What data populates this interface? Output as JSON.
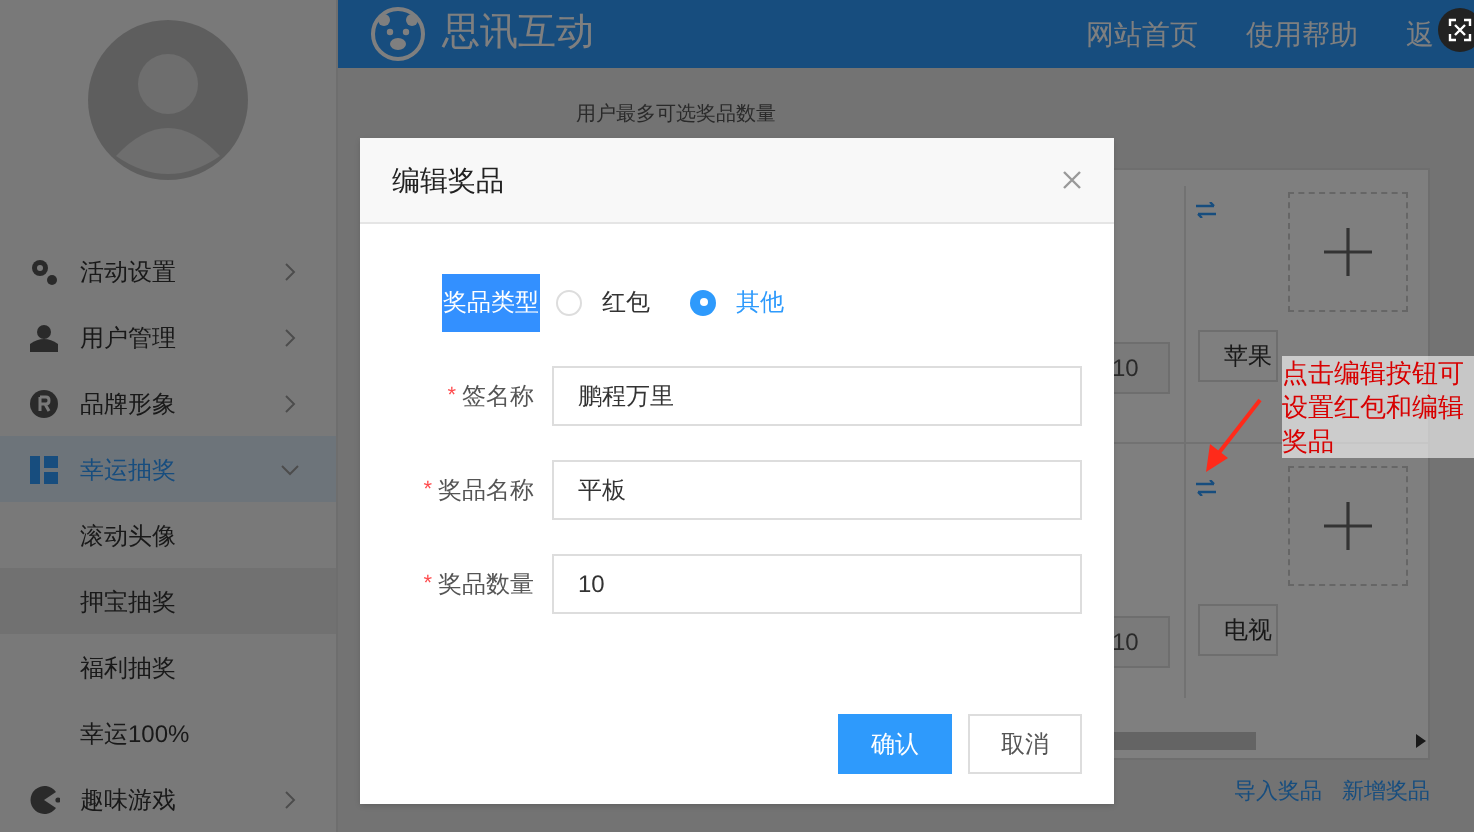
{
  "header": {
    "logo_text": "思讯互动",
    "nav": [
      "网站首页",
      "使用帮助",
      "返"
    ]
  },
  "sidebar": {
    "items": [
      {
        "label": "活动设置",
        "expanded": false,
        "selected": false
      },
      {
        "label": "用户管理",
        "expanded": false,
        "selected": false
      },
      {
        "label": "品牌形象",
        "expanded": false,
        "selected": false
      },
      {
        "label": "幸运抽奖",
        "expanded": true,
        "selected": true,
        "children": [
          {
            "label": "滚动头像",
            "selected": false
          },
          {
            "label": "押宝抽奖",
            "selected": true
          },
          {
            "label": "福利抽奖",
            "selected": false
          },
          {
            "label": "幸运100%",
            "selected": false
          }
        ]
      },
      {
        "label": "趣味游戏",
        "expanded": false,
        "selected": false
      }
    ]
  },
  "page": {
    "hint": "用户最多可选奖品数量",
    "prizes": [
      {
        "quantity": "10",
        "name": "苹果"
      },
      {
        "quantity": "10",
        "name": "电视"
      }
    ],
    "links": [
      "导入奖品",
      "新增奖品"
    ]
  },
  "dialog": {
    "title": "编辑奖品",
    "prize_type": {
      "label": "奖品类型",
      "highlighted": true,
      "options": [
        {
          "label": "红包",
          "selected": false
        },
        {
          "label": "其他",
          "selected": true
        }
      ]
    },
    "fields": [
      {
        "label": "签名称",
        "value": "鹏程万里",
        "required_mark": "*"
      },
      {
        "label": "奖品名称",
        "value": "平板",
        "required_mark": "*"
      },
      {
        "label": "奖品数量",
        "value": "10",
        "required_mark": "*"
      }
    ],
    "buttons": [
      {
        "label": "确认",
        "kind": "primary"
      },
      {
        "label": "取消",
        "kind": "default"
      }
    ]
  },
  "annotation": {
    "text": "点击编辑按钮可设置红包和编辑奖品"
  }
}
